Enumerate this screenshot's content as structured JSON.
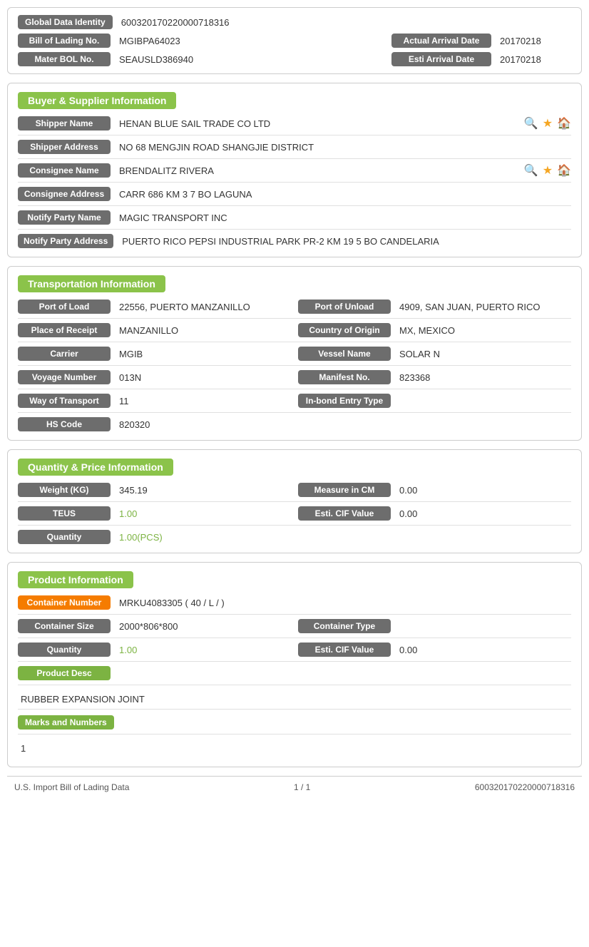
{
  "topCard": {
    "rows": [
      {
        "left": {
          "label": "Global Data Identity",
          "value": "600320170220000718316"
        },
        "right": null
      },
      {
        "left": {
          "label": "Bill of Lading No.",
          "value": "MGIBPA64023"
        },
        "right": {
          "label": "Actual Arrival Date",
          "value": "20170218"
        }
      },
      {
        "left": {
          "label": "Mater BOL No.",
          "value": "SEAUSLD386940"
        },
        "right": {
          "label": "Esti Arrival Date",
          "value": "20170218"
        }
      }
    ]
  },
  "buyerSupplier": {
    "sectionTitle": "Buyer & Supplier Information",
    "rows": [
      {
        "label": "Shipper Name",
        "value": "HENAN BLUE SAIL TRADE CO LTD",
        "hasIcons": true
      },
      {
        "label": "Shipper Address",
        "value": "NO 68 MENGJIN ROAD SHANGJIE DISTRICT",
        "hasIcons": false
      },
      {
        "label": "Consignee Name",
        "value": "BRENDALITZ RIVERA",
        "hasIcons": true
      },
      {
        "label": "Consignee Address",
        "value": "CARR 686 KM 3 7 BO LAGUNA",
        "hasIcons": false
      },
      {
        "label": "Notify Party Name",
        "value": "MAGIC TRANSPORT INC",
        "hasIcons": false
      },
      {
        "label": "Notify Party Address",
        "value": "PUERTO RICO PEPSI INDUSTRIAL PARK PR-2 KM 19 5 BO CANDELARIA",
        "hasIcons": false
      }
    ]
  },
  "transportation": {
    "sectionTitle": "Transportation Information",
    "rows": [
      {
        "left": {
          "label": "Port of Load",
          "value": "22556, PUERTO MANZANILLO"
        },
        "right": {
          "label": "Port of Unload",
          "value": "4909, SAN JUAN, PUERTO RICO"
        }
      },
      {
        "left": {
          "label": "Place of Receipt",
          "value": "MANZANILLO"
        },
        "right": {
          "label": "Country of Origin",
          "value": "MX, MEXICO"
        }
      },
      {
        "left": {
          "label": "Carrier",
          "value": "MGIB"
        },
        "right": {
          "label": "Vessel Name",
          "value": "SOLAR N"
        }
      },
      {
        "left": {
          "label": "Voyage Number",
          "value": "013N"
        },
        "right": {
          "label": "Manifest No.",
          "value": "823368"
        }
      },
      {
        "left": {
          "label": "Way of Transport",
          "value": "11"
        },
        "right": {
          "label": "In-bond Entry Type",
          "value": ""
        }
      },
      {
        "left": {
          "label": "HS Code",
          "value": "820320"
        },
        "right": null
      }
    ]
  },
  "quantityPrice": {
    "sectionTitle": "Quantity & Price Information",
    "rows": [
      {
        "left": {
          "label": "Weight (KG)",
          "value": "345.19"
        },
        "right": {
          "label": "Measure in CM",
          "value": "0.00"
        }
      },
      {
        "left": {
          "label": "TEUS",
          "value": "1.00",
          "greenText": true
        },
        "right": {
          "label": "Esti. CIF Value",
          "value": "0.00"
        }
      },
      {
        "left": {
          "label": "Quantity",
          "value": "1.00(PCS)",
          "greenText": true
        },
        "right": null
      }
    ]
  },
  "productInfo": {
    "sectionTitle": "Product Information",
    "containerNumberLabel": "Container Number",
    "containerNumberValue": "MRKU4083305 ( 40 / L / )",
    "rows": [
      {
        "left": {
          "label": "Container Size",
          "value": "2000*806*800"
        },
        "right": {
          "label": "Container Type",
          "value": ""
        }
      },
      {
        "left": {
          "label": "Quantity",
          "value": "1.00",
          "greenText": true
        },
        "right": {
          "label": "Esti. CIF Value",
          "value": "0.00"
        }
      }
    ],
    "productDescLabel": "Product Desc",
    "productDescValue": "RUBBER EXPANSION JOINT",
    "marksLabel": "Marks and Numbers",
    "marksValue": "1"
  },
  "footer": {
    "left": "U.S. Import Bill of Lading Data",
    "center": "1 / 1",
    "right": "600320170220000718316"
  }
}
